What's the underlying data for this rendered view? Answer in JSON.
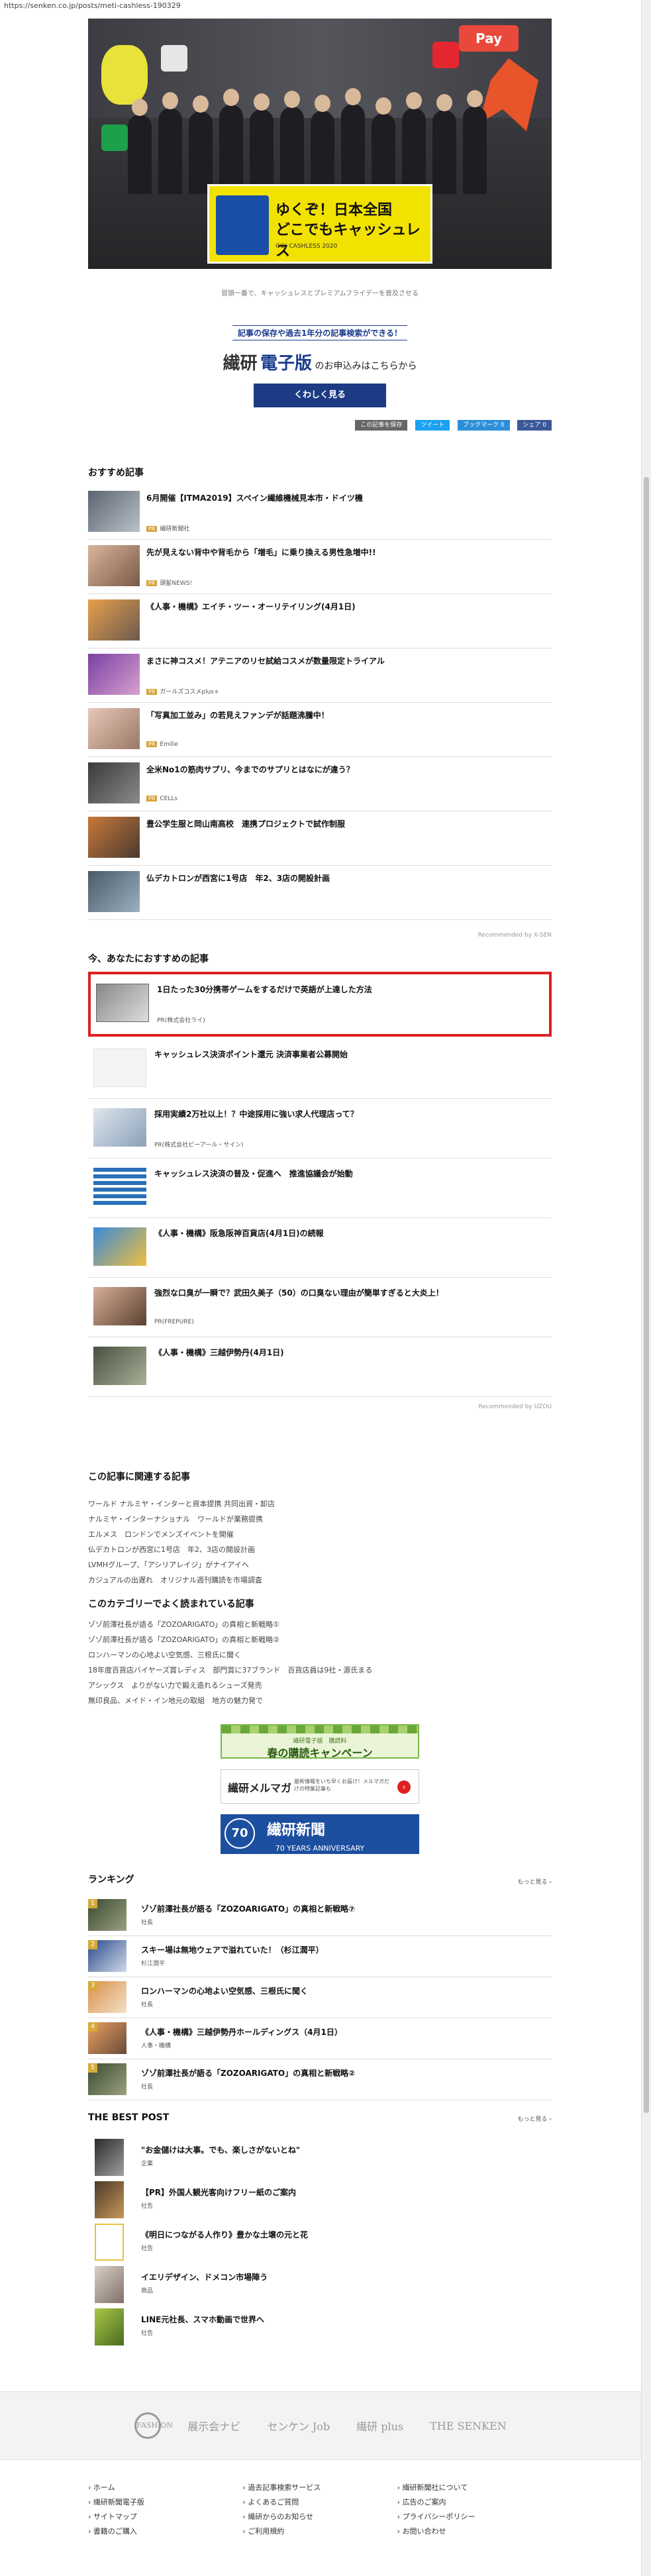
{
  "url": "https://senken.co.jp/posts/meti-cashless-190329",
  "hero": {
    "banner_line1": "ゆくぞ！日本全国",
    "banner_line2": "どこでもキャッシュレス",
    "banner_line3": "GO! CASHLESS 2020",
    "pay_label": "Pay"
  },
  "caption": "冒頭一番で、キャッシュレスとプレミアムフライデーを普及させる",
  "promo": {
    "top": "記事の保存や過去1年分の記事検索ができる！",
    "logo1": "繊研",
    "logo2": "電子版",
    "suffix": "のお申込みはこちらから",
    "button": "くわしく見る"
  },
  "share": [
    "この記事を保存",
    "ツイート",
    "ブックマーク 0",
    "シェア 0"
  ],
  "recommended": {
    "heading": "おすすめ記事",
    "items": [
      {
        "title": "6月開催【ITMA2019】スペイン繊維機械見本市・ドイツ機",
        "sponsor": "繊研新聞社",
        "pr": true
      },
      {
        "title": "先が見えない背中や背毛から「増毛」に乗り換える男性急増中!!",
        "sponsor": "頭髪NEWS!",
        "pr": true
      },
      {
        "title": "《人事・機構》エイチ・ツー・オーリテイリング(4月1日)",
        "sponsor": "",
        "pr": false
      },
      {
        "title": "まさに神コスメ！アテニアのリセ試給コスメが数量限定トライアル",
        "sponsor": "ガールズコスメplus+",
        "pr": true
      },
      {
        "title": "「写真加工並み」の若見えファンデが話題沸騰中！",
        "sponsor": "Emilie",
        "pr": true
      },
      {
        "title": "全米No1の筋肉サプリ、今までのサプリとはなにが違う？",
        "sponsor": "CELLs",
        "pr": true
      },
      {
        "title": "豊公学生服と岡山南高校　連携プロジェクトで試作制服",
        "sponsor": "",
        "pr": false
      },
      {
        "title": "仏デカトロンが西宮に1号店　年2、3店の開設計画",
        "sponsor": "",
        "pr": false
      }
    ],
    "footer": "Recommended by  X-SEN"
  },
  "now_rec": {
    "heading": "今、あなたにおすすめの記事",
    "items": [
      {
        "title": "1日たった30分携帯ゲームをするだけで英語が上達した方法",
        "sponsor": "PR(株式会社ライ)"
      },
      {
        "title": "キャッシュレス決済ポイント還元 決済事業者公募開始",
        "sponsor": ""
      },
      {
        "title": "採用実績2万社以上！？中途採用に強い求人代理店って？",
        "sponsor": "PR(株式会社ビーアール・サイン)"
      },
      {
        "title": "キャッシュレス決済の普及・促進へ　推進協議会が始動",
        "sponsor": ""
      },
      {
        "title": "《人事・機構》阪急阪神百貨店(4月1日)の続報",
        "sponsor": ""
      },
      {
        "title": "強烈な口臭が一瞬で？武田久美子（50）の口臭ない理由が簡単すぎると大炎上！",
        "sponsor": "PR(FREPURE)"
      },
      {
        "title": "《人事・機構》三越伊勢丹(4月1日)",
        "sponsor": ""
      }
    ],
    "footer": "Recommended by  UZOU"
  },
  "related": {
    "heading": "この記事に関連する記事",
    "links": [
      "ワールド ナルミヤ・インターと資本提携 共同出資・卸店",
      "ナルミヤ・インターナショナル　ワールドが業務提携",
      "エルメス　ロンドンでメンズイベントを開催",
      "仏デカトロンが西宮に1号店　年2、3店の開設計画",
      "LVMHグループ、「アシリアレイジ」がナイアイへ",
      "カジュアルの出遅れ　オリジナル週刊購読を市場調査"
    ]
  },
  "category": {
    "heading": "このカテゴリーでよく読まれている記事",
    "links": [
      "ゾゾ前澤社長が語る「ZOZOARIGATO」の真相と新戦略①",
      "ゾゾ前澤社長が語る「ZOZOARIGATO」の真相と新戦略②",
      "ロンハーマンの心地よい空気感、三根氏に聞く",
      "18年度百貨店バイヤーズ賞レディス　部門賞に37ブランド　百貨店員は9社・源氏まる",
      "アシックス　よりがない力で鍛え造れるシューズ発売",
      "無印良品、メイド・イン地元の取組　地方の魅力発で"
    ]
  },
  "banners": {
    "spring": "春の購読キャンペーン",
    "spring_sub": "繊研電子版　購読料",
    "mail_title": "繊研メルマガ",
    "mail_sub": "最新情報をいち早くお届け！メルマガだけの特集記事も",
    "anniv_title": "繊研新聞",
    "anniv_sub": "70 YEARS ANNIVERSARY",
    "anniv_badge": "70"
  },
  "ranking": {
    "heading": "ランキング",
    "more": "もっと見る ›",
    "items": [
      {
        "num": "1",
        "title": "ゾゾ前澤社長が語る「ZOZOARIGATO」の真相と新戦略⑦",
        "cat": "社長"
      },
      {
        "num": "2",
        "title": "スキー場は無地ウェアで溢れていた！（杉江潤平）",
        "cat": "杉江潤平"
      },
      {
        "num": "3",
        "title": "ロンハーマンの心地よい空気感、三根氏に聞く",
        "cat": "社長"
      },
      {
        "num": "4",
        "title": "《人事・機構》三越伊勢丹ホールディングス（4月1日）",
        "cat": "人事・機構"
      },
      {
        "num": "5",
        "title": "ゾゾ前澤社長が語る「ZOZOARIGATO」の真相と新戦略②",
        "cat": "社長"
      }
    ]
  },
  "best": {
    "heading": "THE BEST POST",
    "more": "もっと見る ›",
    "items": [
      {
        "title": "\"お金儲けは大事。でも、楽しさがないとね\"",
        "cat": "企業"
      },
      {
        "title": "【PR】外国人観光客向けフリー紙のご案内",
        "cat": "社告"
      },
      {
        "title": "《明日につながる人作り》豊かな土壌の元と花",
        "cat": "社告"
      },
      {
        "title": "イエリデザイン、ドメコン市場陣う",
        "cat": "商品"
      },
      {
        "title": "LINE元社長、スマホ動画で世界へ",
        "cat": "社告"
      }
    ]
  },
  "footer_logos": [
    "FASHION",
    "展示会ナビ",
    "センケン Job",
    "繊研 plus",
    "THE SENKEN"
  ],
  "footer_links": [
    [
      "ホーム",
      "繊研新聞電子版",
      "サイトマップ",
      "書籍のご購入"
    ],
    [
      "過去記事検索サービス",
      "よくあるご質問",
      "繊研からのお知らせ",
      "ご利用規約"
    ],
    [
      "繊研新聞社について",
      "広告のご案内",
      "プライバシーポリシー",
      "お問い合わせ"
    ]
  ],
  "colors": {
    "navy": "#1c3b84",
    "highlight": "#e02020",
    "pr_badge": "#d6a23a"
  }
}
